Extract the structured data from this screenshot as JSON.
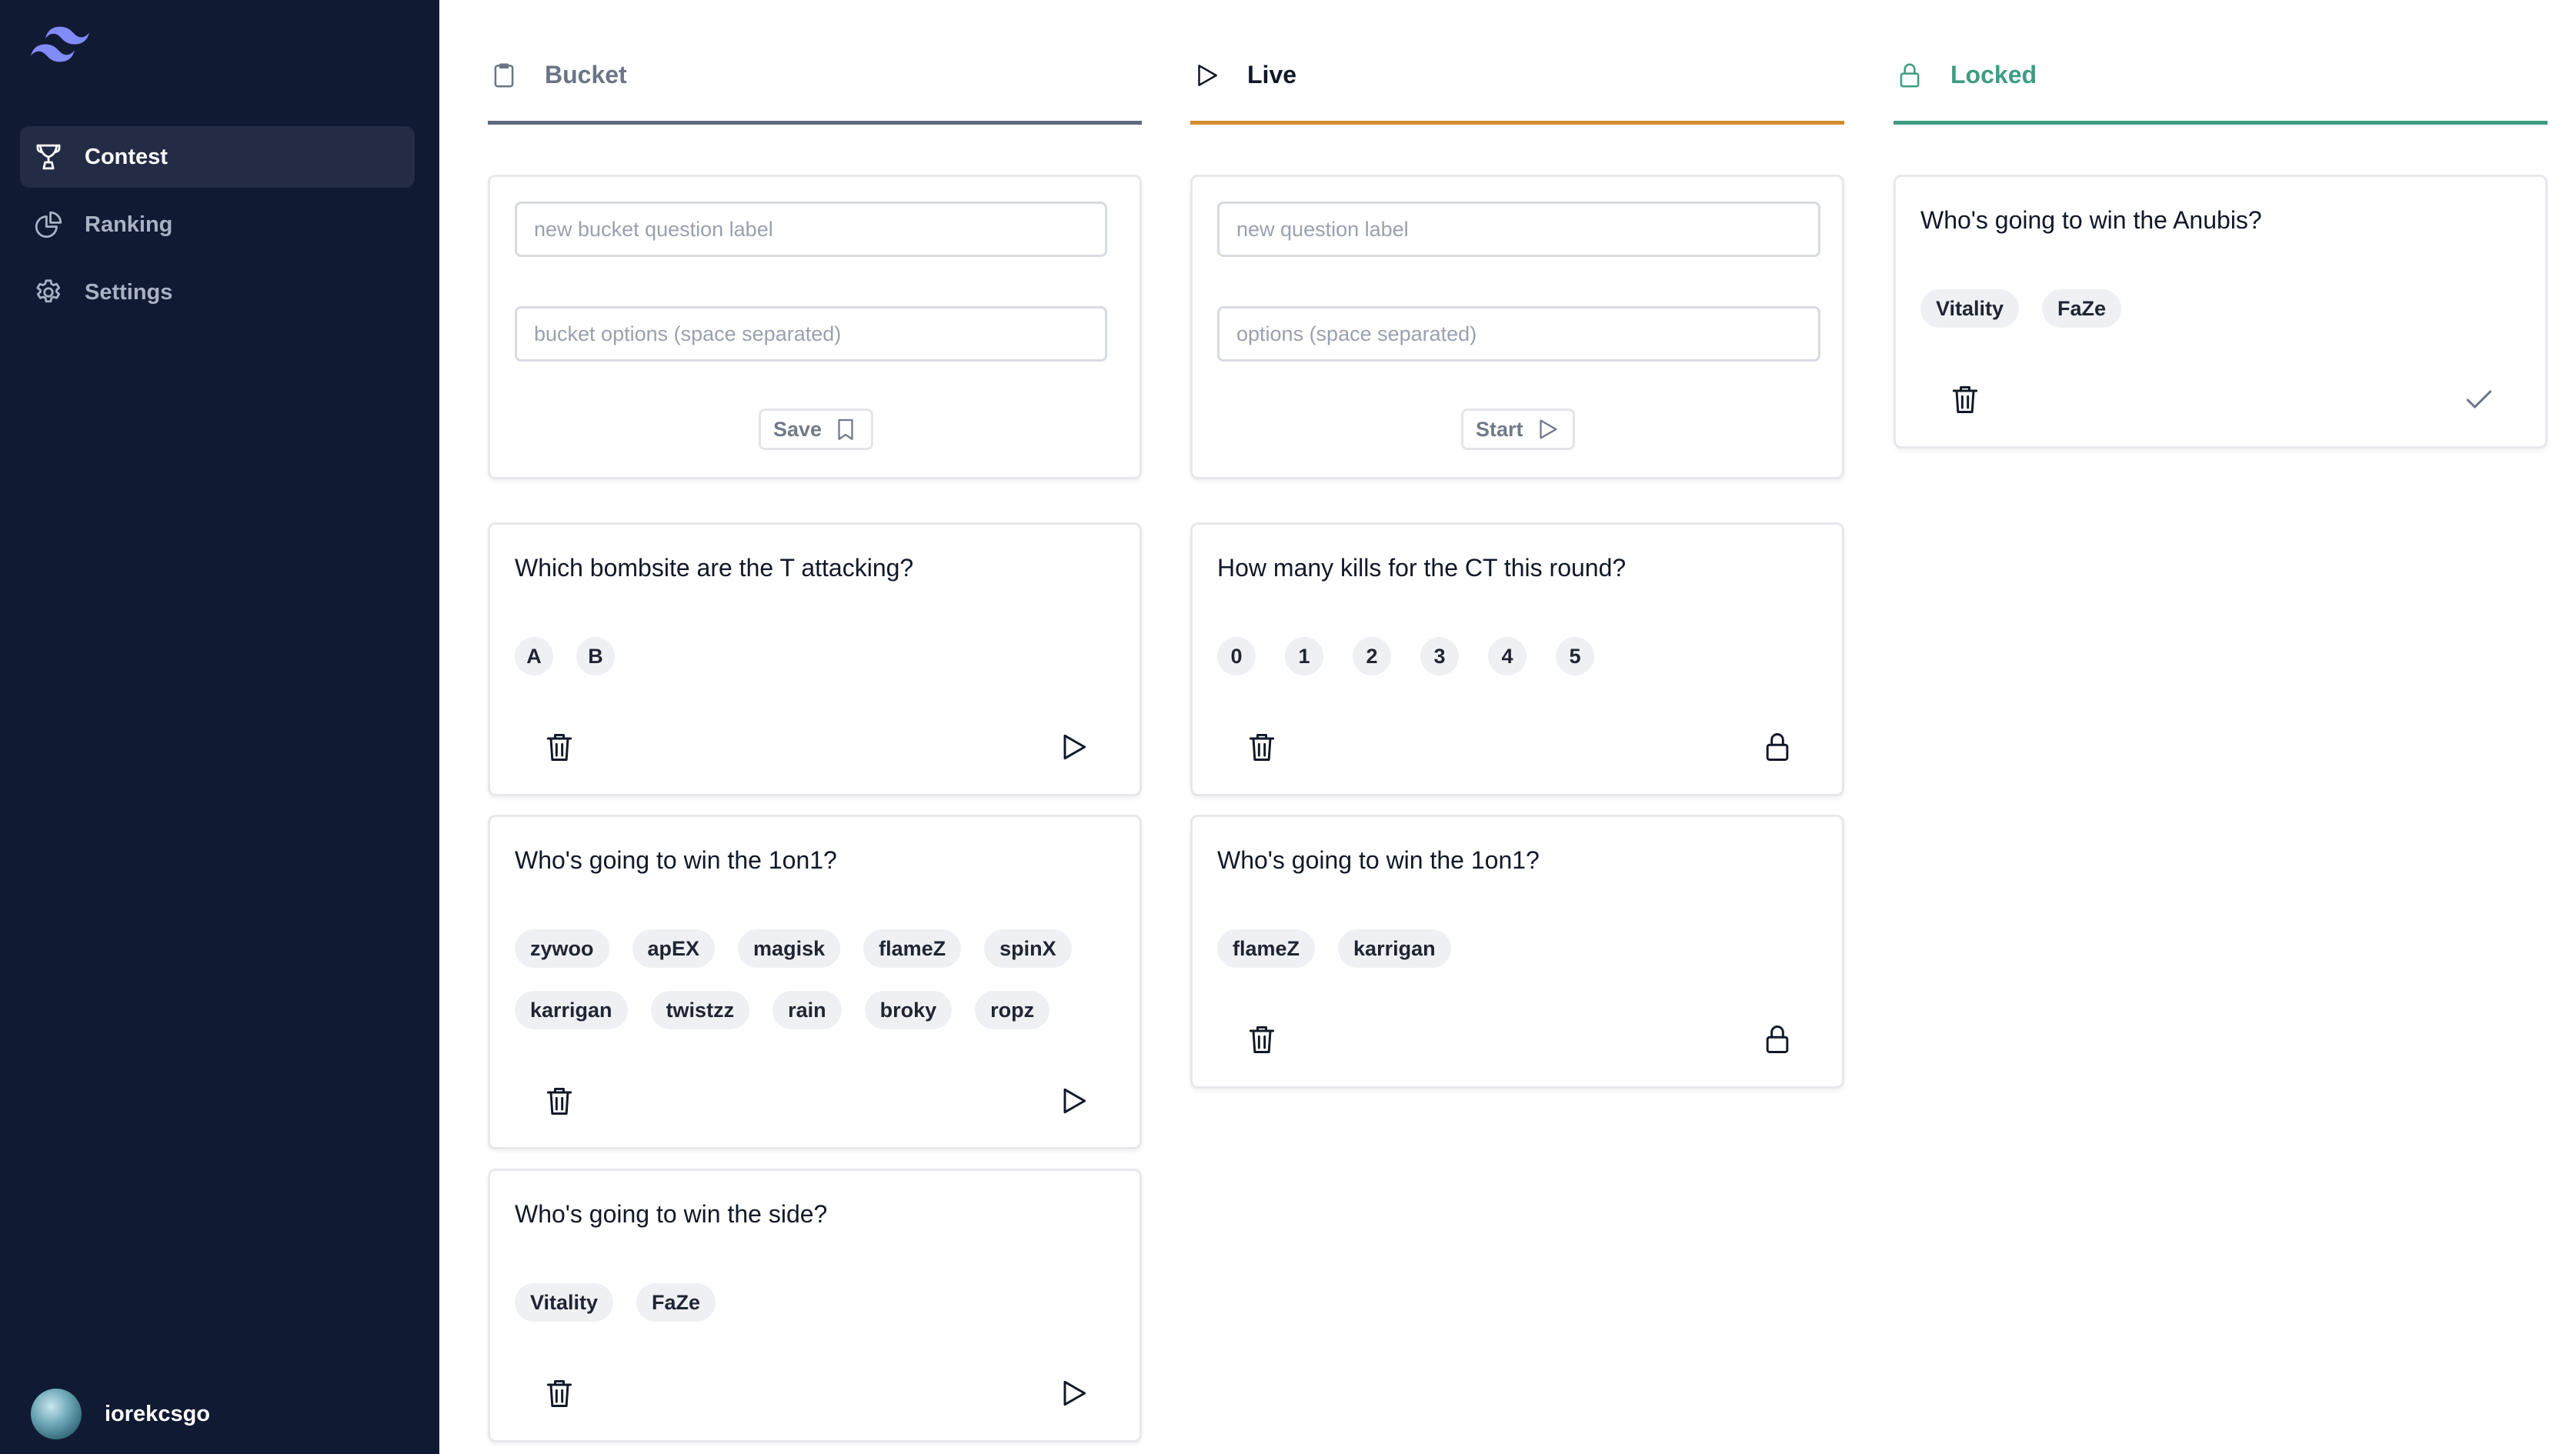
{
  "sidebar": {
    "nav": [
      {
        "label": "Contest",
        "icon": "trophy-icon",
        "active": true
      },
      {
        "label": "Ranking",
        "icon": "chart-pie-icon",
        "active": false
      },
      {
        "label": "Settings",
        "icon": "gear-icon",
        "active": false
      }
    ],
    "user": {
      "name": "iorekcsgo"
    }
  },
  "columns": {
    "bucket": {
      "title": "Bucket",
      "icon": "clipboard-icon",
      "accent": "#5d6b80"
    },
    "live": {
      "title": "Live",
      "icon": "play-icon",
      "accent": "#d48b2e"
    },
    "locked": {
      "title": "Locked",
      "icon": "lock-icon",
      "accent": "#3e9c83"
    }
  },
  "forms": {
    "bucket": {
      "label_placeholder": "new bucket question label",
      "options_placeholder": "bucket options (space separated)",
      "button": "Save"
    },
    "live": {
      "label_placeholder": "new question label",
      "options_placeholder": "options (space separated)",
      "button": "Start"
    }
  },
  "questions": {
    "bucket": [
      {
        "label": "Which bombsite are the T attacking?",
        "options": [
          "A",
          "B"
        ]
      },
      {
        "label": "Who's going to win the 1on1?",
        "options": [
          "zywoo",
          "apEX",
          "magisk",
          "flameZ",
          "spinX",
          "karrigan",
          "twistzz",
          "rain",
          "broky",
          "ropz"
        ]
      },
      {
        "label": "Who's going to win the side?",
        "options": [
          "Vitality",
          "FaZe"
        ]
      }
    ],
    "live": [
      {
        "label": "How many kills for the CT this round?",
        "options": [
          "0",
          "1",
          "2",
          "3",
          "4",
          "5"
        ]
      },
      {
        "label": "Who's going to win the 1on1?",
        "options": [
          "flameZ",
          "karrigan"
        ]
      }
    ],
    "locked": [
      {
        "label": "Who's going to win the Anubis?",
        "options": [
          "Vitality",
          "FaZe"
        ]
      }
    ]
  }
}
